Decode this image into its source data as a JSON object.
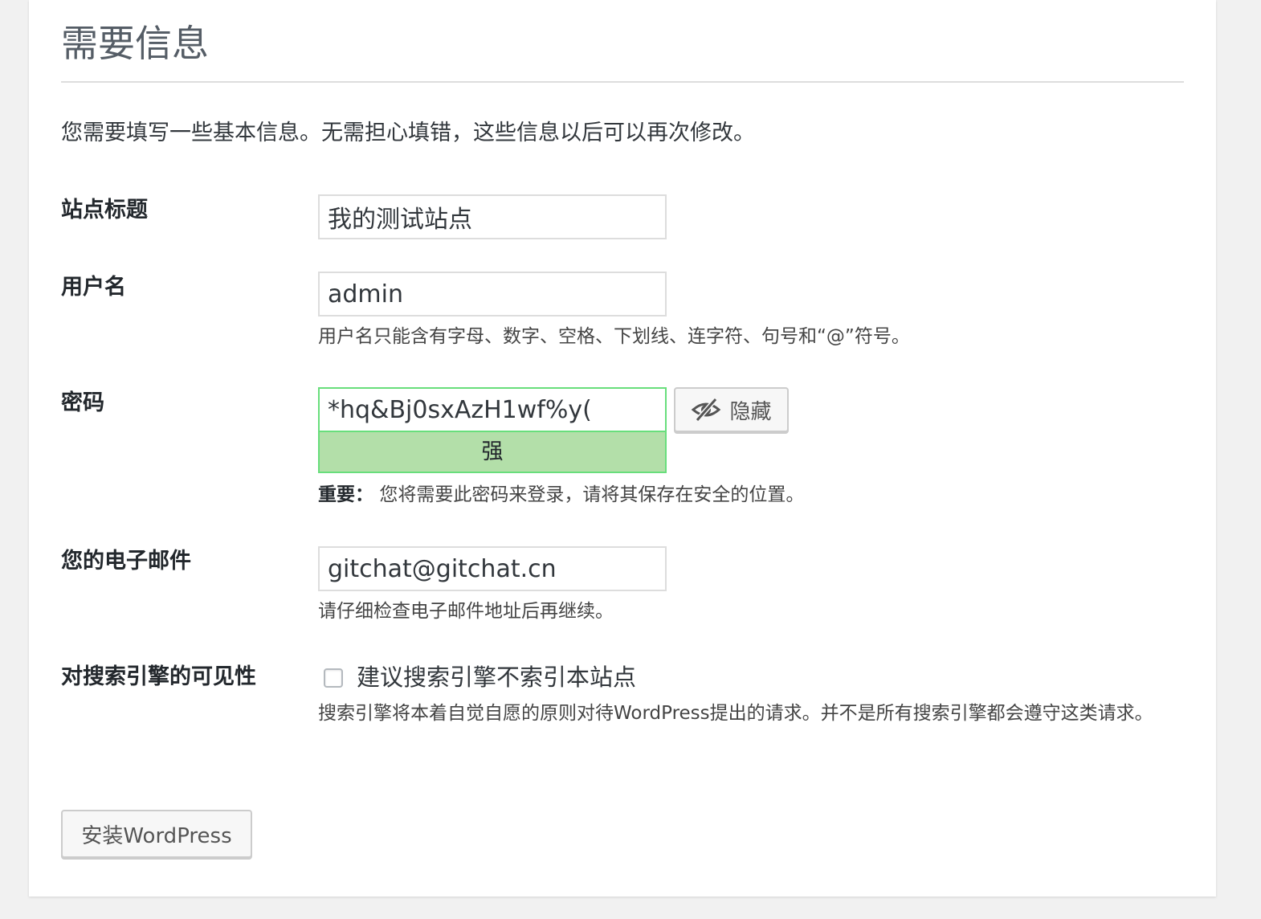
{
  "page": {
    "title": "需要信息",
    "intro": "您需要填写一些基本信息。无需担心填错，这些信息以后可以再次修改。"
  },
  "site_title": {
    "label": "站点标题",
    "value": "我的测试站点"
  },
  "username": {
    "label": "用户名",
    "value": "admin",
    "hint": "用户名只能含有字母、数字、空格、下划线、连字符、句号和“@”符号。"
  },
  "password": {
    "label": "密码",
    "value": "*hq&Bj0sxAzH1wf%y(",
    "strength": "强",
    "strength_color": "#b3dfa9",
    "hide_button_label": "隐藏",
    "hide_icon": "eye-slash-icon",
    "hint_strong": "重要：",
    "hint": "您将需要此密码来登录，请将其保存在安全的位置。"
  },
  "email": {
    "label": "您的电子邮件",
    "value": "gitchat@gitchat.cn",
    "hint": "请仔细检查电子邮件地址后再继续。"
  },
  "search_visibility": {
    "label": "对搜索引擎的可见性",
    "checkbox_label": "建议搜索引擎不索引本站点",
    "checked": false,
    "hint": "搜索引擎将本着自觉自愿的原则对待WordPress提出的请求。并不是所有搜索引擎都会遵守这类请求。"
  },
  "actions": {
    "install_label": "安装WordPress"
  }
}
